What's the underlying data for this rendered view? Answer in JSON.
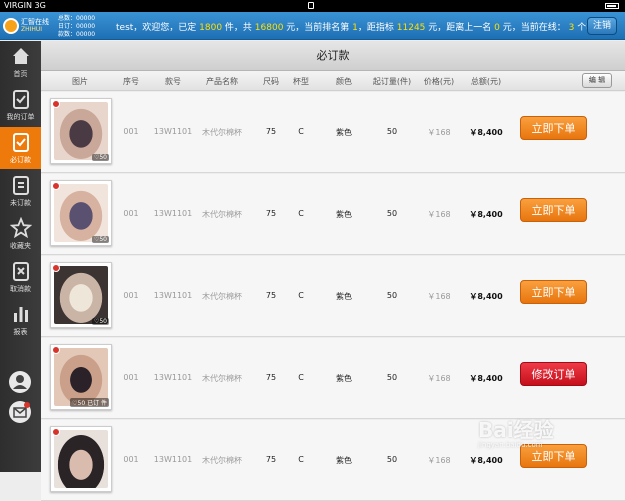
{
  "statusbar": {
    "carrier": "VIRGIN  3G"
  },
  "topbar": {
    "logo_text": "汇智在线",
    "logo_sub": "ZHIHUI",
    "mini_stats": [
      "总数：00000",
      "日订：00000",
      "款数：00000"
    ],
    "welcome": {
      "p1": "test，欢迎您，已定 ",
      "pieces": "1800",
      "p2": " 件，共 ",
      "amount": "16800",
      "p3": " 元，当前排名第 ",
      "rank": "1",
      "p4": "，距指标 ",
      "target": "11245",
      "p5": " 元，距离上一名 ",
      "gap": "0",
      "p6": " 元，当前在线： ",
      "online": "3",
      "p7": " 个客户"
    },
    "logout_label": "注销"
  },
  "sidebar": {
    "items": [
      {
        "label": "首页"
      },
      {
        "label": "我的订单"
      },
      {
        "label": "必订款"
      },
      {
        "label": "未订款"
      },
      {
        "label": "收藏夹"
      },
      {
        "label": "取消款"
      },
      {
        "label": "报表"
      }
    ]
  },
  "page": {
    "title": "必订款"
  },
  "table": {
    "headers": [
      "图片",
      "序号",
      "款号",
      "产品名称",
      "尺码",
      "杯型",
      "颜色",
      "起订量(件)",
      "价格(元)",
      "总额(元)"
    ],
    "edit_label": "编 辑",
    "rows": [
      {
        "likes": "♡50",
        "seq": "001",
        "code": "13W1101",
        "name": "木代尔棉杯",
        "size": "75",
        "cup": "C",
        "color": "紫色",
        "min_qty": "50",
        "price": "￥168",
        "total": "￥8,400",
        "action": "立即下单"
      },
      {
        "likes": "♡50",
        "seq": "001",
        "code": "13W1101",
        "name": "木代尔棉杯",
        "size": "75",
        "cup": "C",
        "color": "紫色",
        "min_qty": "50",
        "price": "￥168",
        "total": "￥8,400",
        "action": "立即下单"
      },
      {
        "likes": "♡50",
        "seq": "001",
        "code": "13W1101",
        "name": "木代尔棉杯",
        "size": "75",
        "cup": "C",
        "color": "紫色",
        "min_qty": "50",
        "price": "￥168",
        "total": "￥8,400",
        "action": "立即下单"
      },
      {
        "likes": "♡50  已订  件",
        "seq": "001",
        "code": "13W1101",
        "name": "木代尔棉杯",
        "size": "75",
        "cup": "C",
        "color": "紫色",
        "min_qty": "50",
        "price": "￥168",
        "total": "￥8,400",
        "action": "修改订单"
      },
      {
        "likes": "",
        "seq": "001",
        "code": "13W1101",
        "name": "木代尔棉杯",
        "size": "75",
        "cup": "C",
        "color": "紫色",
        "min_qty": "50",
        "price": "￥168",
        "total": "￥8,400",
        "action": "立即下单"
      }
    ]
  },
  "watermark": {
    "text": "Bai经验",
    "sub": "jingyan.baidu.com"
  },
  "colors": {
    "accent": "#ee7a0b",
    "topbar": "#2a82c6",
    "modify": "#d4202c"
  }
}
